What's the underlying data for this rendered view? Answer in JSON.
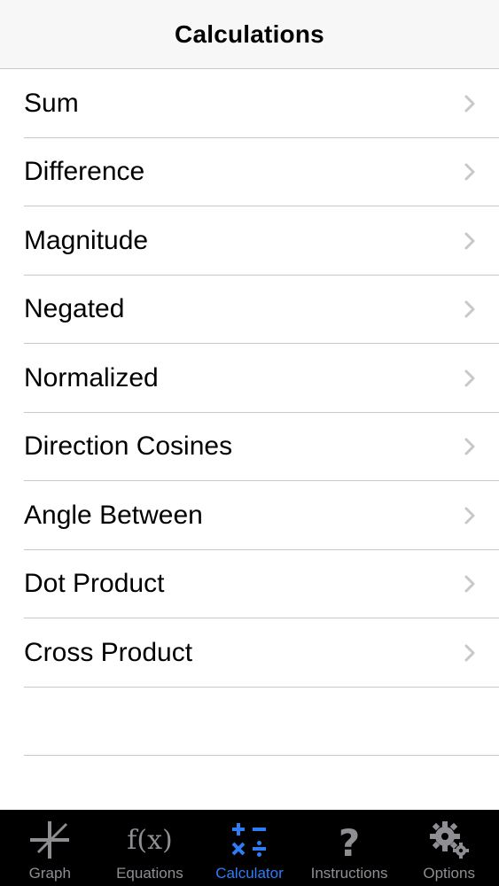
{
  "navbar": {
    "title": "Calculations"
  },
  "list": {
    "items": [
      {
        "label": "Sum"
      },
      {
        "label": "Difference"
      },
      {
        "label": "Magnitude"
      },
      {
        "label": "Negated"
      },
      {
        "label": "Normalized"
      },
      {
        "label": "Direction Cosines"
      },
      {
        "label": "Angle Between"
      },
      {
        "label": "Dot Product"
      },
      {
        "label": "Cross Product"
      }
    ],
    "chevron_icon": "chevron-right-icon"
  },
  "tabbar": {
    "tabs": [
      {
        "label": "Graph",
        "icon": "graph-axes-icon",
        "active": false
      },
      {
        "label": "Equations",
        "icon": "fx-icon",
        "active": false
      },
      {
        "label": "Calculator",
        "icon": "calculator-operators-icon",
        "active": true
      },
      {
        "label": "Instructions",
        "icon": "question-mark-icon",
        "active": false
      },
      {
        "label": "Options",
        "icon": "gears-icon",
        "active": false
      }
    ]
  },
  "colors": {
    "accent": "#2f7df6",
    "tab_inactive": "#8e8e93",
    "separator": "#c8c7cc",
    "chevron": "#c7c7cc",
    "tabbar_bg": "#000000",
    "navbar_bg": "#f7f7f7"
  }
}
